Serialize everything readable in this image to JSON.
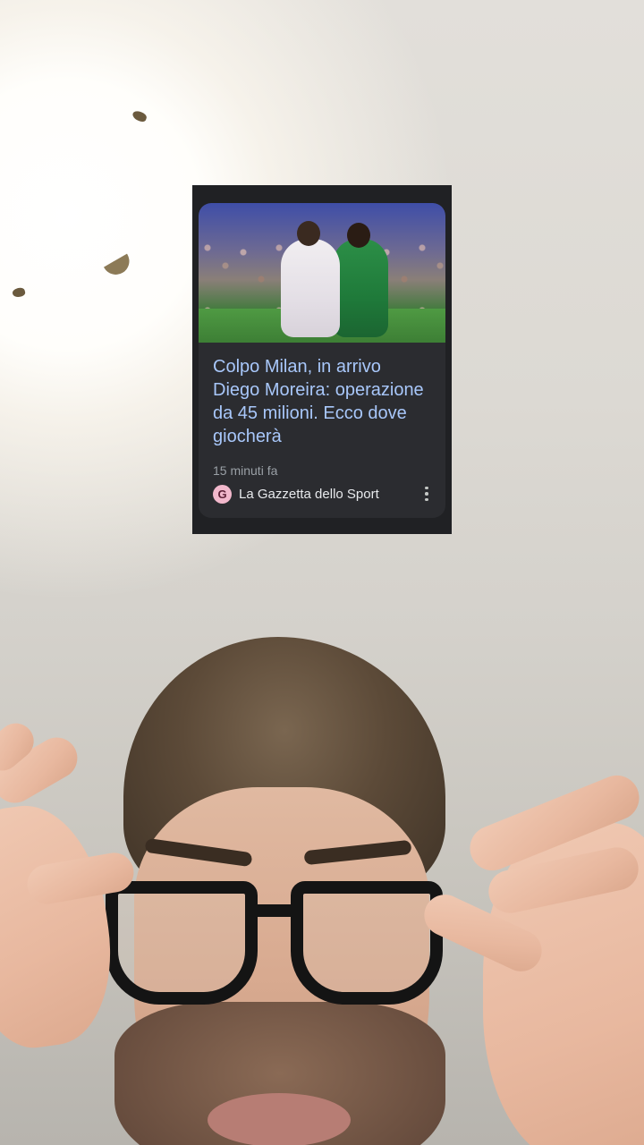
{
  "news_card": {
    "headline": "Colpo Milan, in arrivo Diego Moreira: operazione da 45 milioni. Ecco dove giocherà",
    "time": "15 minuti fa",
    "source": {
      "name": "La Gazzetta dello Sport",
      "logo_letter": "G",
      "logo_color": "#f2b8cc"
    },
    "more_icon": "more-vert-icon"
  },
  "colors": {
    "card_background": "#202124",
    "card_inner": "#2b2c30",
    "headline": "#a8c7fa",
    "meta_text": "#9aa0a6"
  }
}
